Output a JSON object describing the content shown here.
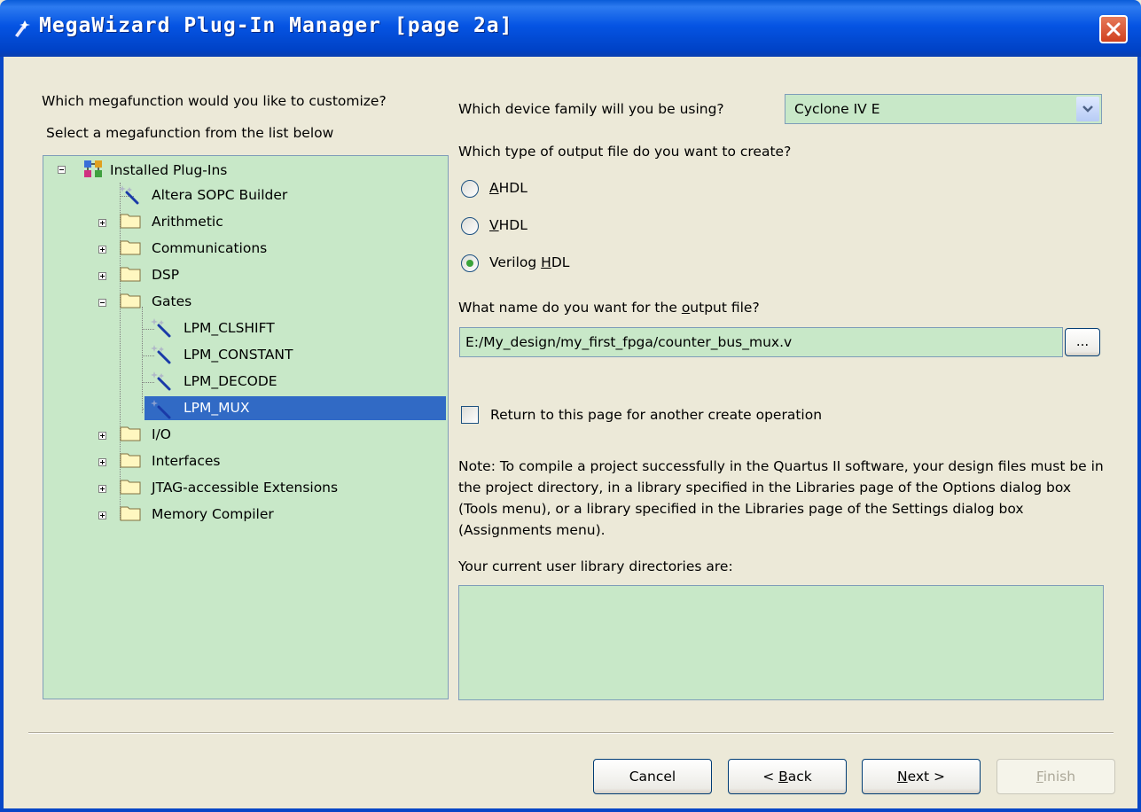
{
  "window": {
    "title": "MegaWizard Plug-In Manager [page 2a]"
  },
  "left": {
    "question": "Which megafunction would you like to customize?",
    "hint": "Select a megafunction from the list below",
    "tree": {
      "root": "Installed Plug-Ins",
      "items": [
        {
          "label": "Altera SOPC Builder",
          "kind": "wand-icon"
        },
        {
          "label": "Arithmetic",
          "kind": "folder-icon"
        },
        {
          "label": "Communications",
          "kind": "folder-icon"
        },
        {
          "label": "DSP",
          "kind": "folder-icon"
        },
        {
          "label": "Gates",
          "kind": "folder-icon",
          "expanded": true
        },
        {
          "label": "LPM_CLSHIFT",
          "kind": "wand-icon"
        },
        {
          "label": "LPM_CONSTANT",
          "kind": "wand-icon"
        },
        {
          "label": "LPM_DECODE",
          "kind": "wand-icon"
        },
        {
          "label": "LPM_MUX",
          "kind": "wand-icon",
          "selected": true
        },
        {
          "label": "I/O",
          "kind": "folder-icon"
        },
        {
          "label": "Interfaces",
          "kind": "folder-icon"
        },
        {
          "label": "JTAG-accessible Extensions",
          "kind": "folder-icon"
        },
        {
          "label": "Memory Compiler",
          "kind": "folder-icon"
        }
      ]
    }
  },
  "right": {
    "device_question": "Which device family will you be using?",
    "device_value": "Cyclone IV E",
    "output_type_question": "Which type of output file do you want to create?",
    "output_types": [
      {
        "pre": "",
        "key": "A",
        "post": "HDL",
        "checked": false
      },
      {
        "pre": "",
        "key": "V",
        "post": "HDL",
        "checked": false
      },
      {
        "pre": "Verilog ",
        "key": "H",
        "post": "DL",
        "checked": true
      }
    ],
    "name_question_pre": "What name do you want for the ",
    "name_question_key": "o",
    "name_question_post": "utput file?",
    "output_file": "E:/My_design/my_first_fpga/counter_bus_mux.v",
    "browse_label": "...",
    "return_label": "Return to this page for another create operation",
    "note": "Note: To compile a project successfully in the Quartus II software, your design files must be in the project directory, in a library specified in the Libraries page of the Options dialog box (Tools menu), or a library specified in the Libraries page of the Settings dialog box (Assignments menu).",
    "library_label": "Your current user library directories are:"
  },
  "buttons": {
    "cancel": "Cancel",
    "back_pre": "< ",
    "back_key": "B",
    "back_post": "ack",
    "next_key": "N",
    "next_post": "ext >",
    "finish_key": "F",
    "finish_post": "inish"
  },
  "colors": {
    "field_bg": "#c8e8c8",
    "selection": "#316ac5",
    "titlebar": "#0554e3"
  }
}
